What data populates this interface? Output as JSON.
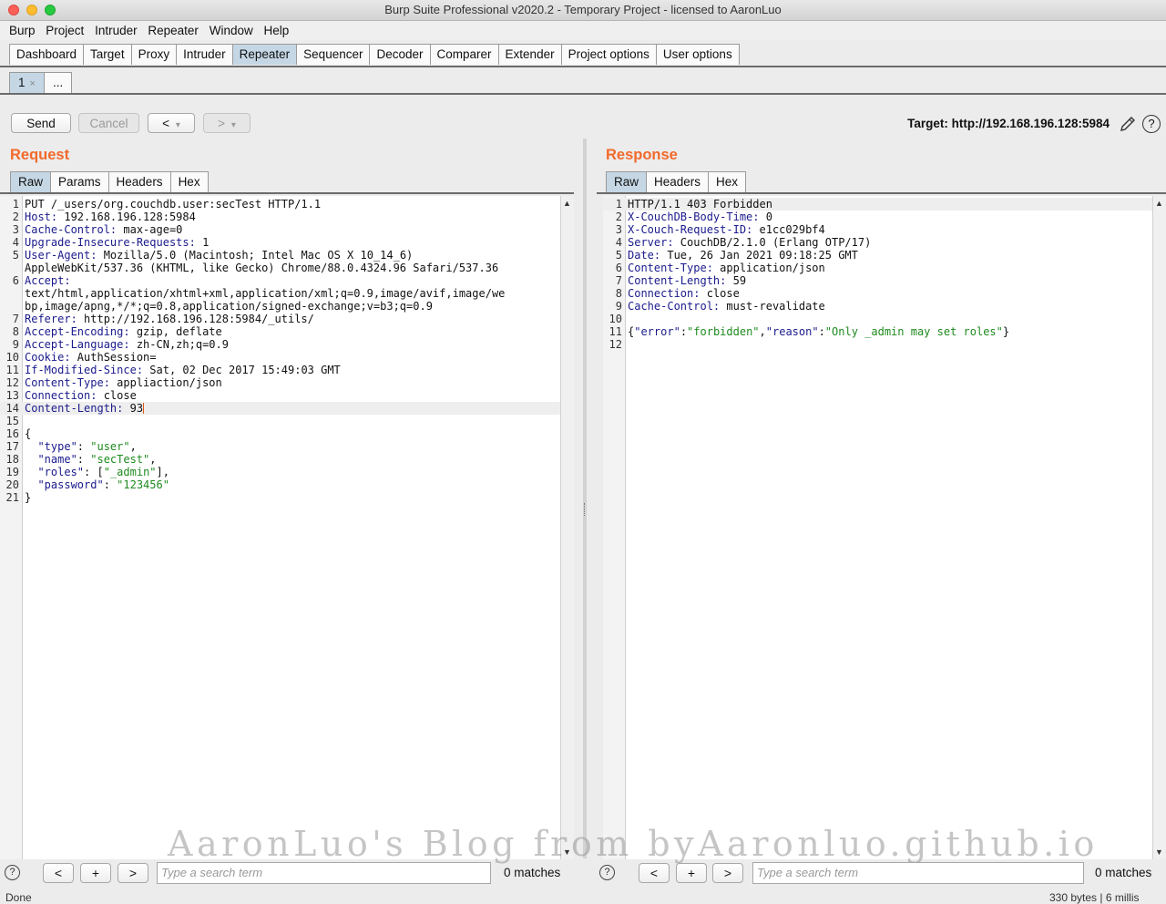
{
  "window": {
    "title": "Burp Suite Professional v2020.2 - Temporary Project - licensed to AaronLuo"
  },
  "menu": [
    "Burp",
    "Project",
    "Intruder",
    "Repeater",
    "Window",
    "Help"
  ],
  "main_tabs": [
    {
      "label": "Dashboard"
    },
    {
      "label": "Target"
    },
    {
      "label": "Proxy"
    },
    {
      "label": "Intruder"
    },
    {
      "label": "Repeater",
      "active": true
    },
    {
      "label": "Sequencer"
    },
    {
      "label": "Decoder"
    },
    {
      "label": "Comparer"
    },
    {
      "label": "Extender"
    },
    {
      "label": "Project options"
    },
    {
      "label": "User options"
    }
  ],
  "repeater_tabs": [
    {
      "label": "1",
      "close": "×"
    },
    {
      "label": "..."
    }
  ],
  "toolbar": {
    "send": "Send",
    "cancel": "Cancel",
    "back": "<",
    "forward": ">",
    "dropdown": "▾"
  },
  "target": "Target: http://192.168.196.128:5984",
  "request": {
    "title": "Request",
    "tabs": [
      "Raw",
      "Params",
      "Headers",
      "Hex"
    ],
    "lines": [
      {
        "n": "1",
        "text": "PUT /_users/org.couchdb.user:secTest HTTP/1.1"
      },
      {
        "n": "2",
        "key": "Host:",
        "val": " 192.168.196.128:5984"
      },
      {
        "n": "3",
        "key": "Cache-Control:",
        "val": " max-age=0"
      },
      {
        "n": "4",
        "key": "Upgrade-Insecure-Requests:",
        "val": " 1"
      },
      {
        "n": "5",
        "key": "User-Agent:",
        "val": " Mozilla/5.0 (Macintosh; Intel Mac OS X 10_14_6)"
      },
      {
        "n": "",
        "text": "AppleWebKit/537.36 (KHTML, like Gecko) Chrome/88.0.4324.96 Safari/537.36"
      },
      {
        "n": "6",
        "key": "Accept:",
        "val": ""
      },
      {
        "n": "",
        "text": "text/html,application/xhtml+xml,application/xml;q=0.9,image/avif,image/we"
      },
      {
        "n": "",
        "text": "bp,image/apng,*/*;q=0.8,application/signed-exchange;v=b3;q=0.9"
      },
      {
        "n": "7",
        "key": "Referer:",
        "val": " http://192.168.196.128:5984/_utils/"
      },
      {
        "n": "8",
        "key": "Accept-Encoding:",
        "val": " gzip, deflate"
      },
      {
        "n": "9",
        "key": "Accept-Language:",
        "val": " zh-CN,zh;q=0.9"
      },
      {
        "n": "10",
        "key": "Cookie:",
        "val": " AuthSession="
      },
      {
        "n": "11",
        "key": "If-Modified-Since:",
        "val": " Sat, 02 Dec 2017 15:49:03 GMT"
      },
      {
        "n": "12",
        "key": "Content-Type:",
        "val": " appliaction/json"
      },
      {
        "n": "13",
        "key": "Connection:",
        "val": " close"
      },
      {
        "n": "14",
        "key": "Content-Length:",
        "val": " 93",
        "current": true
      },
      {
        "n": "15",
        "text": ""
      },
      {
        "n": "16",
        "text": "{"
      },
      {
        "n": "17",
        "jk": "  \"type\"",
        "sep": ": ",
        "js": "\"user\"",
        "end": ","
      },
      {
        "n": "18",
        "jk": "  \"name\"",
        "sep": ": ",
        "js": "\"secTest\"",
        "end": ","
      },
      {
        "n": "19",
        "jk": "  \"roles\"",
        "sep": ": [",
        "js": "\"_admin\"",
        "end": "],"
      },
      {
        "n": "20",
        "jk": "  \"password\"",
        "sep": ": ",
        "js": "\"123456\"",
        "end": ""
      },
      {
        "n": "21",
        "text": "}"
      }
    ],
    "search_placeholder": "Type a search term",
    "matches": "0 matches"
  },
  "response": {
    "title": "Response",
    "tabs": [
      "Raw",
      "Headers",
      "Hex"
    ],
    "lines": [
      {
        "n": "1",
        "text": "HTTP/1.1 403 Forbidden",
        "current": true
      },
      {
        "n": "2",
        "key": "X-CouchDB-Body-Time:",
        "val": " 0"
      },
      {
        "n": "3",
        "key": "X-Couch-Request-ID:",
        "val": " e1cc029bf4"
      },
      {
        "n": "4",
        "key": "Server:",
        "val": " CouchDB/2.1.0 (Erlang OTP/17)"
      },
      {
        "n": "5",
        "key": "Date:",
        "val": " Tue, 26 Jan 2021 09:18:25 GMT"
      },
      {
        "n": "6",
        "key": "Content-Type:",
        "val": " application/json"
      },
      {
        "n": "7",
        "key": "Content-Length:",
        "val": " 59"
      },
      {
        "n": "8",
        "key": "Connection:",
        "val": " close"
      },
      {
        "n": "9",
        "key": "Cache-Control:",
        "val": " must-revalidate"
      },
      {
        "n": "10",
        "text": ""
      },
      {
        "n": "11",
        "json_inline": [
          {
            "t": "{",
            "c": ""
          },
          {
            "t": "\"error\"",
            "c": "jk"
          },
          {
            "t": ":",
            "c": ""
          },
          {
            "t": "\"forbidden\"",
            "c": "js"
          },
          {
            "t": ",",
            "c": ""
          },
          {
            "t": "\"reason\"",
            "c": "jk"
          },
          {
            "t": ":",
            "c": ""
          },
          {
            "t": "\"Only _admin may set roles\"",
            "c": "js"
          },
          {
            "t": "}",
            "c": ""
          }
        ]
      },
      {
        "n": "12",
        "text": ""
      }
    ],
    "search_placeholder": "Type a search term",
    "matches": "0 matches"
  },
  "search_nav": {
    "prev": "<",
    "add": "+",
    "next": ">",
    "help": "?"
  },
  "watermark": "AaronLuo's Blog from byAaronluo.github.io",
  "status": {
    "left": "Done",
    "right": "330 bytes | 6 millis"
  },
  "colors": {
    "accent": "#f26a2b",
    "active_tab": "#c5d7e5",
    "header_key": "#1a1a8c",
    "json_string": "#1e8a1e"
  }
}
